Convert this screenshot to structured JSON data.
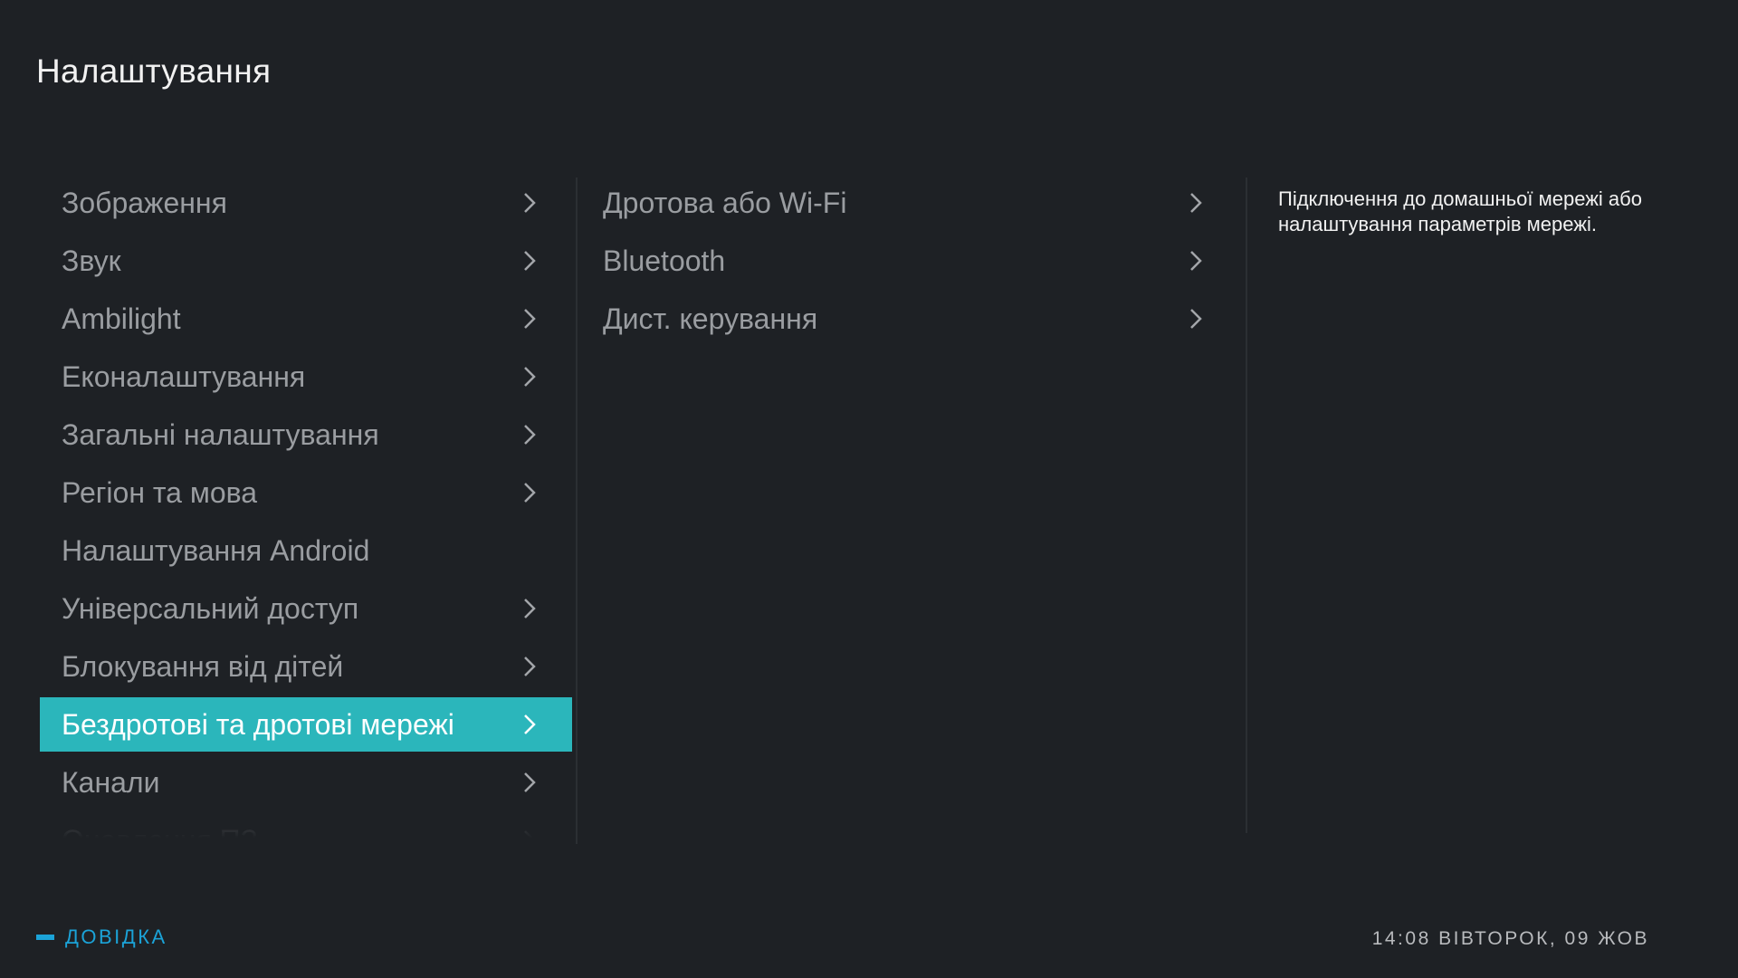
{
  "header": {
    "title": "Налаштування"
  },
  "menu": {
    "items": [
      {
        "label": "Зображення",
        "has_submenu": true
      },
      {
        "label": "Звук",
        "has_submenu": true
      },
      {
        "label": "Ambilight",
        "has_submenu": true
      },
      {
        "label": "Еконалаштування",
        "has_submenu": true
      },
      {
        "label": "Загальні налаштування",
        "has_submenu": true
      },
      {
        "label": "Регіон та мова",
        "has_submenu": true
      },
      {
        "label": "Налаштування Android",
        "has_submenu": false
      },
      {
        "label": "Універсальний доступ",
        "has_submenu": true
      },
      {
        "label": "Блокування від дітей",
        "has_submenu": true
      },
      {
        "label": "Бездротові та дротові мережі",
        "has_submenu": true,
        "selected": true
      },
      {
        "label": "Канали",
        "has_submenu": true
      },
      {
        "label": "Оновлення ПЗ",
        "has_submenu": true
      }
    ]
  },
  "submenu": {
    "items": [
      {
        "label": "Дротова або Wi-Fi"
      },
      {
        "label": "Bluetooth"
      },
      {
        "label": "Дист. керування"
      }
    ]
  },
  "description": {
    "text": "Підключення до домашньої мережі або налаштування параметрів мережі."
  },
  "footer": {
    "help_label": "ДОВІДКА",
    "datetime": "14:08 ВІВТОРОК, 09 ЖОВ"
  },
  "colors": {
    "background": "#1e2125",
    "accent_selected": "#2bb6bb",
    "help_accent": "#1ba3d8",
    "text_inactive": "#9a9da1"
  },
  "icons": {
    "chevron": "chevron-right-icon",
    "help": "help-bar-icon"
  }
}
